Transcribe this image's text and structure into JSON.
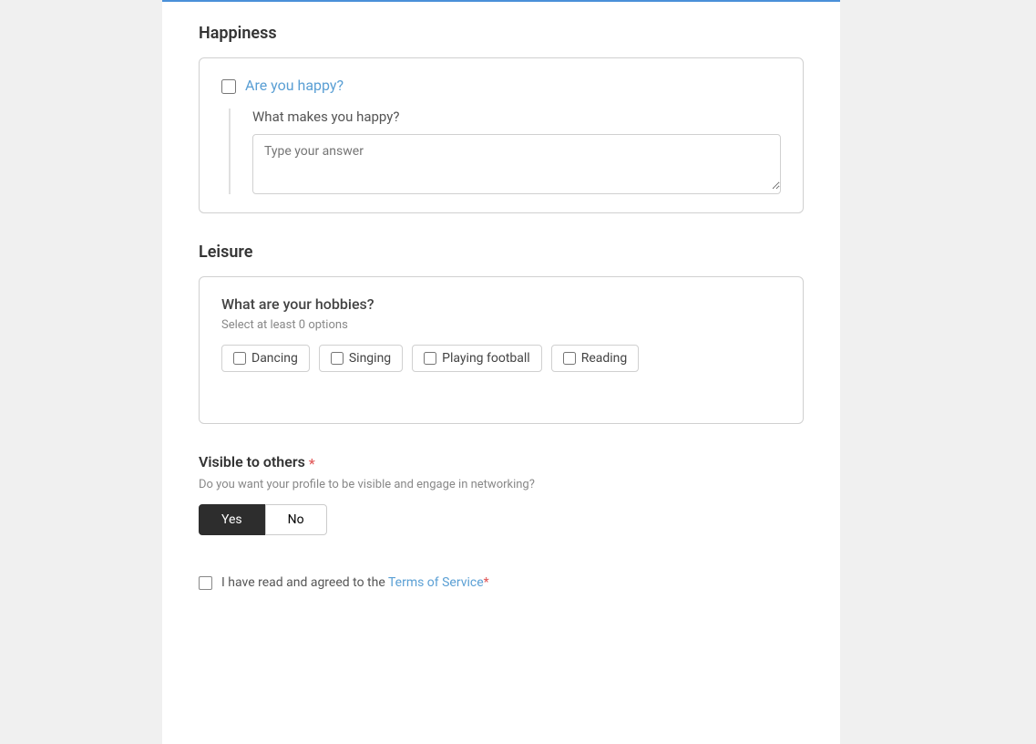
{
  "sections": {
    "happiness": {
      "title": "Happiness",
      "card": {
        "question": "Are you happy?",
        "sub_question": "What makes you happy?",
        "textarea_placeholder": "Type your answer"
      }
    },
    "leisure": {
      "title": "Leisure",
      "card": {
        "question": "What are your hobbies?",
        "select_hint": "Select at least 0 options",
        "options": [
          {
            "label": "Dancing",
            "checked": false
          },
          {
            "label": "Singing",
            "checked": false
          },
          {
            "label": "Playing football",
            "checked": false
          },
          {
            "label": "Reading",
            "checked": false
          }
        ]
      }
    },
    "visible": {
      "title": "Visible to others",
      "required": true,
      "description": "Do you want your profile to be visible and engage in networking?",
      "options": [
        {
          "label": "Yes",
          "active": true
        },
        {
          "label": "No",
          "active": false
        }
      ]
    },
    "tos": {
      "text": "I have read and agreed to the",
      "link_text": "Terms of Service",
      "required": true
    }
  }
}
